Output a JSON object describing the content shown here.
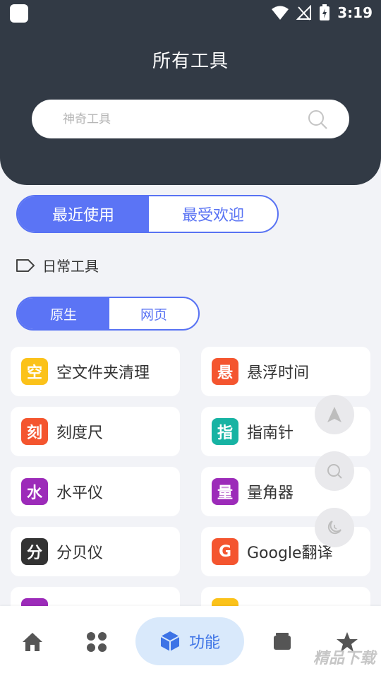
{
  "status_bar": {
    "time": "3:19"
  },
  "header": {
    "title": "所有工具"
  },
  "search": {
    "placeholder": "神奇工具",
    "value": ""
  },
  "tabs_primary": {
    "options": [
      "最近使用",
      "最受欢迎"
    ],
    "selected": "最近使用"
  },
  "section": {
    "label": "日常工具"
  },
  "tabs_secondary": {
    "options": [
      "原生",
      "网页"
    ],
    "selected": "原生"
  },
  "tools": [
    {
      "badge": "空",
      "label": "空文件夹清理",
      "color": "#fbc21a"
    },
    {
      "badge": "悬",
      "label": "悬浮时间",
      "color": "#f4552f"
    },
    {
      "badge": "刻",
      "label": "刻度尺",
      "color": "#f4552f"
    },
    {
      "badge": "指",
      "label": "指南针",
      "color": "#17b3a3"
    },
    {
      "badge": "水",
      "label": "水平仪",
      "color": "#9c2bb9"
    },
    {
      "badge": "量",
      "label": "量角器",
      "color": "#9c2bb9"
    },
    {
      "badge": "分",
      "label": "分贝仪",
      "color": "#333333"
    },
    {
      "badge": "G",
      "label": "Google翻译",
      "color": "#f4552f"
    },
    {
      "badge": "",
      "label": "",
      "color": "#9c2bb9"
    },
    {
      "badge": "",
      "label": "",
      "color": "#fbc21a"
    }
  ],
  "floating_buttons": [
    "navigation-arrow-icon",
    "search-icon",
    "night-mode-icon"
  ],
  "bottom_nav": {
    "items": [
      "home-icon",
      "apps-grid-icon",
      "feature-cube-icon",
      "layers-icon",
      "star-icon"
    ],
    "active_label": "功能"
  },
  "watermark": "精品下载",
  "colors": {
    "header_bg": "#323a45",
    "accent": "#5b74f5",
    "nav_active_bg": "#d9e9fb",
    "nav_active_text": "#3d73e6"
  }
}
